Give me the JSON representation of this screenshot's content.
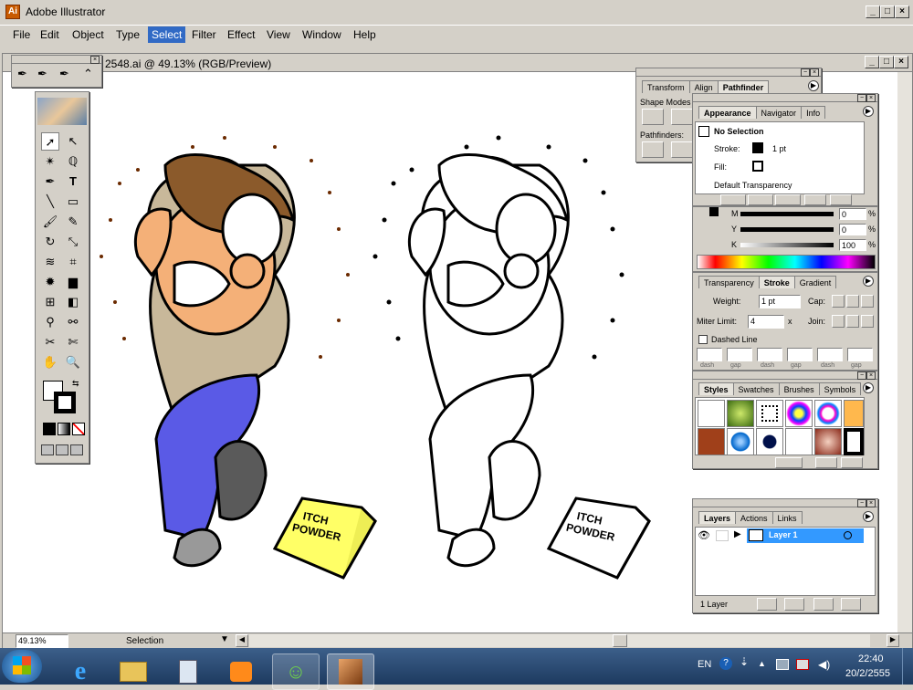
{
  "app": {
    "title": "Adobe Illustrator"
  },
  "menu": [
    "File",
    "Edit",
    "Object",
    "Type",
    "Select",
    "Filter",
    "Effect",
    "View",
    "Window",
    "Help"
  ],
  "document": {
    "title": "2548.ai @ 49.13% (RGB/Preview)"
  },
  "status": {
    "zoom": "49.13%",
    "mode": "Selection"
  },
  "pathfinder": {
    "tabs": [
      "Transform",
      "Align",
      "Pathfinder"
    ],
    "shape_modes": "Shape Modes",
    "pathfinders": "Pathfinders:"
  },
  "appearance": {
    "tabs": [
      "Appearance",
      "Navigator",
      "Info"
    ],
    "selection": "No Selection",
    "stroke_label": "Stroke:",
    "stroke_value": "1 pt",
    "fill_label": "Fill:",
    "transparency": "Default Transparency"
  },
  "color": {
    "m_label": "M",
    "y_label": "Y",
    "k_label": "K",
    "m_value": "0",
    "y_value": "0",
    "k_value": "100",
    "pct": "%"
  },
  "stroke": {
    "tabs": [
      "Transparency",
      "Stroke",
      "Gradient"
    ],
    "weight_label": "Weight:",
    "weight_value": "1 pt",
    "cap_label": "Cap:",
    "miter_label": "Miter Limit:",
    "miter_value": "4",
    "miter_x": "x",
    "join_label": "Join:",
    "dashed_label": "Dashed Line",
    "dash_labels": [
      "dash",
      "gap",
      "dash",
      "gap",
      "dash",
      "gap"
    ]
  },
  "styles": {
    "tabs": [
      "Styles",
      "Swatches",
      "Brushes",
      "Symbols"
    ]
  },
  "layers": {
    "tabs": [
      "Layers",
      "Actions",
      "Links"
    ],
    "layer_name": "Layer 1",
    "count": "1 Layer"
  },
  "artwork": {
    "label_line1": "ITCH",
    "label_line2": "POWDER"
  },
  "taskbar": {
    "lang": "EN",
    "time": "22:40",
    "date": "20/2/2555"
  },
  "colors": {
    "titlebar": "#d4d0c8",
    "select_highlight": "#316ac5",
    "layer_highlight": "#3399ff",
    "taskbar": "#1d3a5f"
  }
}
